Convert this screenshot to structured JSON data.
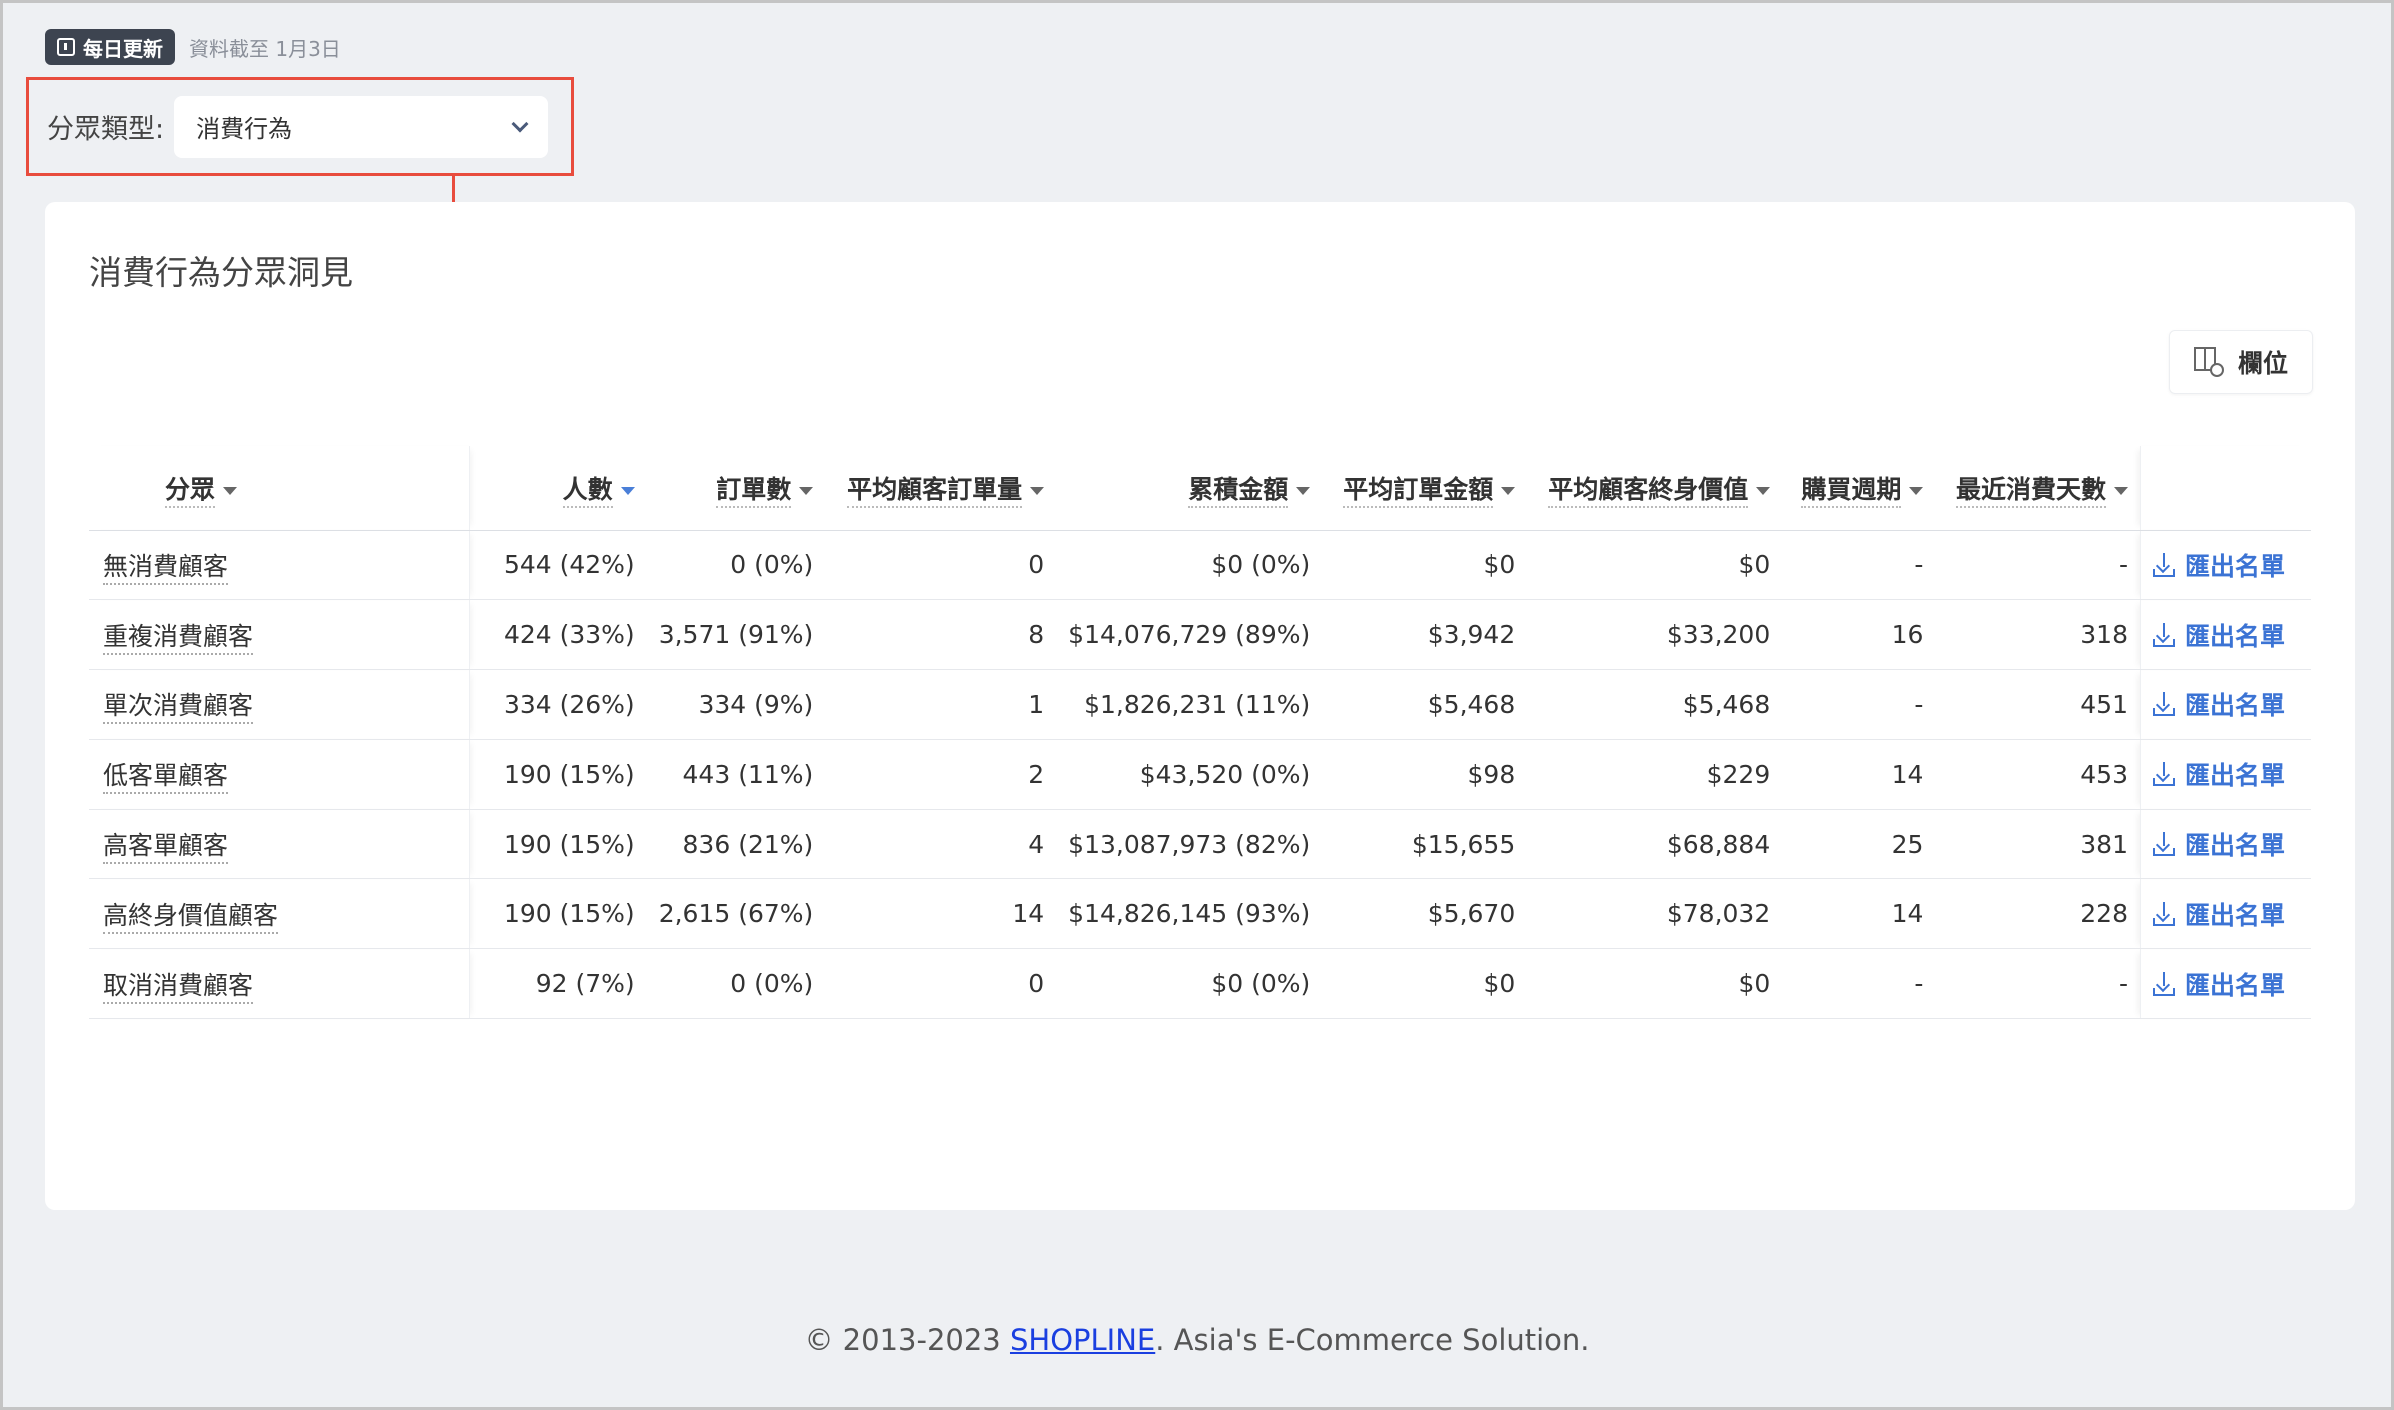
{
  "status": {
    "badge_label": "每日更新",
    "cutoff_text": "資料截至 1月3日"
  },
  "filter": {
    "label": "分眾類型:",
    "selected": "消費行為"
  },
  "card": {
    "title": "消費行為分眾洞見",
    "columns_button": "欄位"
  },
  "table": {
    "headers": {
      "segment": "分眾",
      "people": "人數",
      "orders": "訂單數",
      "avg_orders": "平均顧客訂單量",
      "total_amount": "累積金額",
      "avg_order_amount": "平均訂單金額",
      "avg_ltv": "平均顧客終身價值",
      "purchase_cycle": "購買週期",
      "recent_days": "最近消費天數"
    },
    "export_label": "匯出名單",
    "rows": [
      {
        "segment": "無消費顧客",
        "people": "544 (42%)",
        "orders": "0 (0%)",
        "avg_orders": "0",
        "total_amount": "$0 (0%)",
        "avg_order_amount": "$0",
        "avg_ltv": "$0",
        "purchase_cycle": "-",
        "recent_days": "-"
      },
      {
        "segment": "重複消費顧客",
        "people": "424 (33%)",
        "orders": "3,571 (91%)",
        "avg_orders": "8",
        "total_amount": "$14,076,729 (89%)",
        "avg_order_amount": "$3,942",
        "avg_ltv": "$33,200",
        "purchase_cycle": "16",
        "recent_days": "318"
      },
      {
        "segment": "單次消費顧客",
        "people": "334 (26%)",
        "orders": "334 (9%)",
        "avg_orders": "1",
        "total_amount": "$1,826,231 (11%)",
        "avg_order_amount": "$5,468",
        "avg_ltv": "$5,468",
        "purchase_cycle": "-",
        "recent_days": "451"
      },
      {
        "segment": "低客單顧客",
        "people": "190 (15%)",
        "orders": "443 (11%)",
        "avg_orders": "2",
        "total_amount": "$43,520 (0%)",
        "avg_order_amount": "$98",
        "avg_ltv": "$229",
        "purchase_cycle": "14",
        "recent_days": "453"
      },
      {
        "segment": "高客單顧客",
        "people": "190 (15%)",
        "orders": "836 (21%)",
        "avg_orders": "4",
        "total_amount": "$13,087,973 (82%)",
        "avg_order_amount": "$15,655",
        "avg_ltv": "$68,884",
        "purchase_cycle": "25",
        "recent_days": "381"
      },
      {
        "segment": "高終身價值顧客",
        "people": "190 (15%)",
        "orders": "2,615 (67%)",
        "avg_orders": "14",
        "total_amount": "$14,826,145 (93%)",
        "avg_order_amount": "$5,670",
        "avg_ltv": "$78,032",
        "purchase_cycle": "14",
        "recent_days": "228"
      },
      {
        "segment": "取消消費顧客",
        "people": "92 (7%)",
        "orders": "0 (0%)",
        "avg_orders": "0",
        "total_amount": "$0 (0%)",
        "avg_order_amount": "$0",
        "avg_ltv": "$0",
        "purchase_cycle": "-",
        "recent_days": "-"
      }
    ]
  },
  "footer": {
    "prefix": "© 2013-2023 ",
    "link": "SHOPLINE",
    "suffix": ". Asia's E-Commerce Solution."
  },
  "colors": {
    "accent_red": "#e84c3d",
    "link_blue": "#3b73d4",
    "badge_bg": "#3d4450"
  }
}
